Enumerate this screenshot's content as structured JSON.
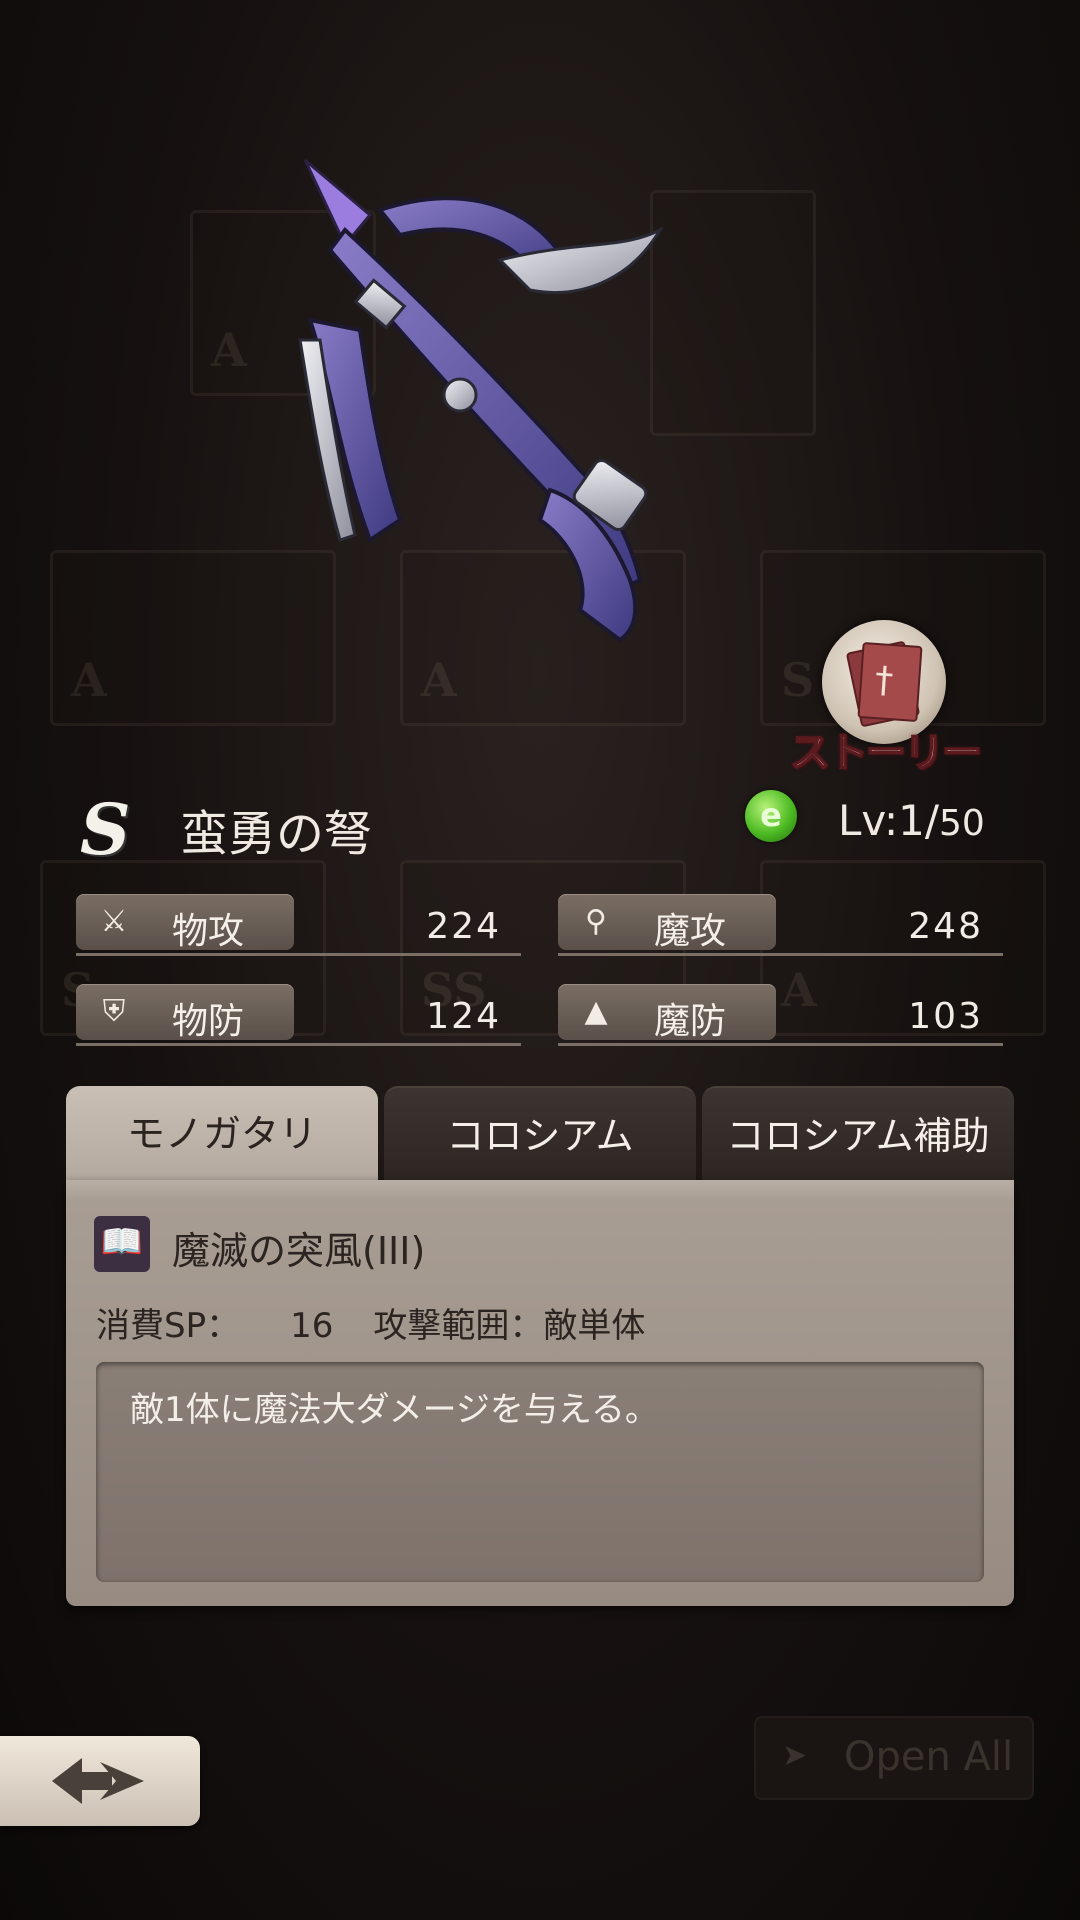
{
  "item": {
    "rank": "S",
    "name": "蛮勇の弩",
    "level_current": "Lv:1/",
    "level_max": "50",
    "element_icon": "wind-element-icon",
    "story_label": "ストーリー"
  },
  "stats": [
    {
      "icon": "sword-icon",
      "label": "物攻",
      "value": "224"
    },
    {
      "icon": "wand-icon",
      "label": "魔攻",
      "value": "248"
    },
    {
      "icon": "shield-icon",
      "label": "物防",
      "value": "124"
    },
    {
      "icon": "wizard-hat-icon",
      "label": "魔防",
      "value": "103"
    }
  ],
  "tabs": [
    {
      "label": "モノガタリ",
      "active": true
    },
    {
      "label": "コロシアム",
      "active": false
    },
    {
      "label": "コロシアム補助",
      "active": false
    }
  ],
  "skill": {
    "icon": "book-icon",
    "name": "魔滅の突風(III)",
    "sp_label": "消費SP：",
    "sp_value": "16",
    "range": "攻撃範囲：敵単体",
    "description": "敵1体に魔法大ダメージを与える。"
  },
  "bottom": {
    "back_icon": "back-arrow-icon",
    "open_all_label": "Open All"
  },
  "colors": {
    "tab_active": "#c9bfb5",
    "panel": "#a99e94",
    "stat_pill": "#6b6058"
  }
}
